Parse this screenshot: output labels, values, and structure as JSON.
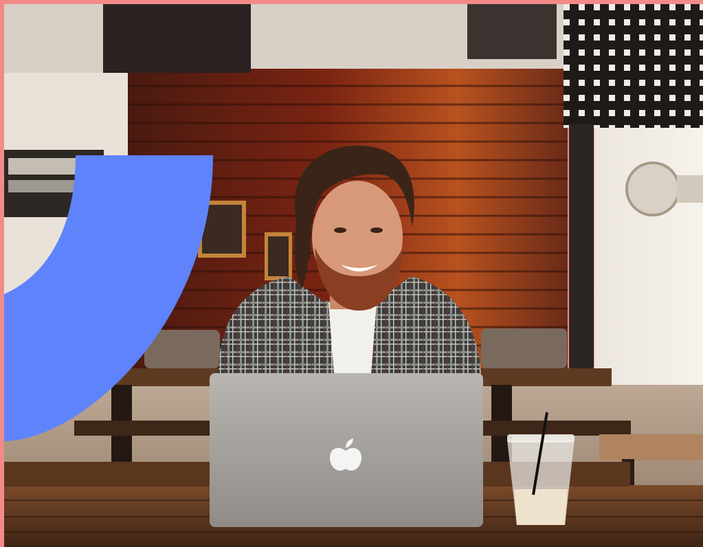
{
  "photo": {
    "subject": "smiling-man-with-laptop-at-cafe-table",
    "frame_color": "#f28a8a",
    "arc_color": "#5f83fb"
  }
}
